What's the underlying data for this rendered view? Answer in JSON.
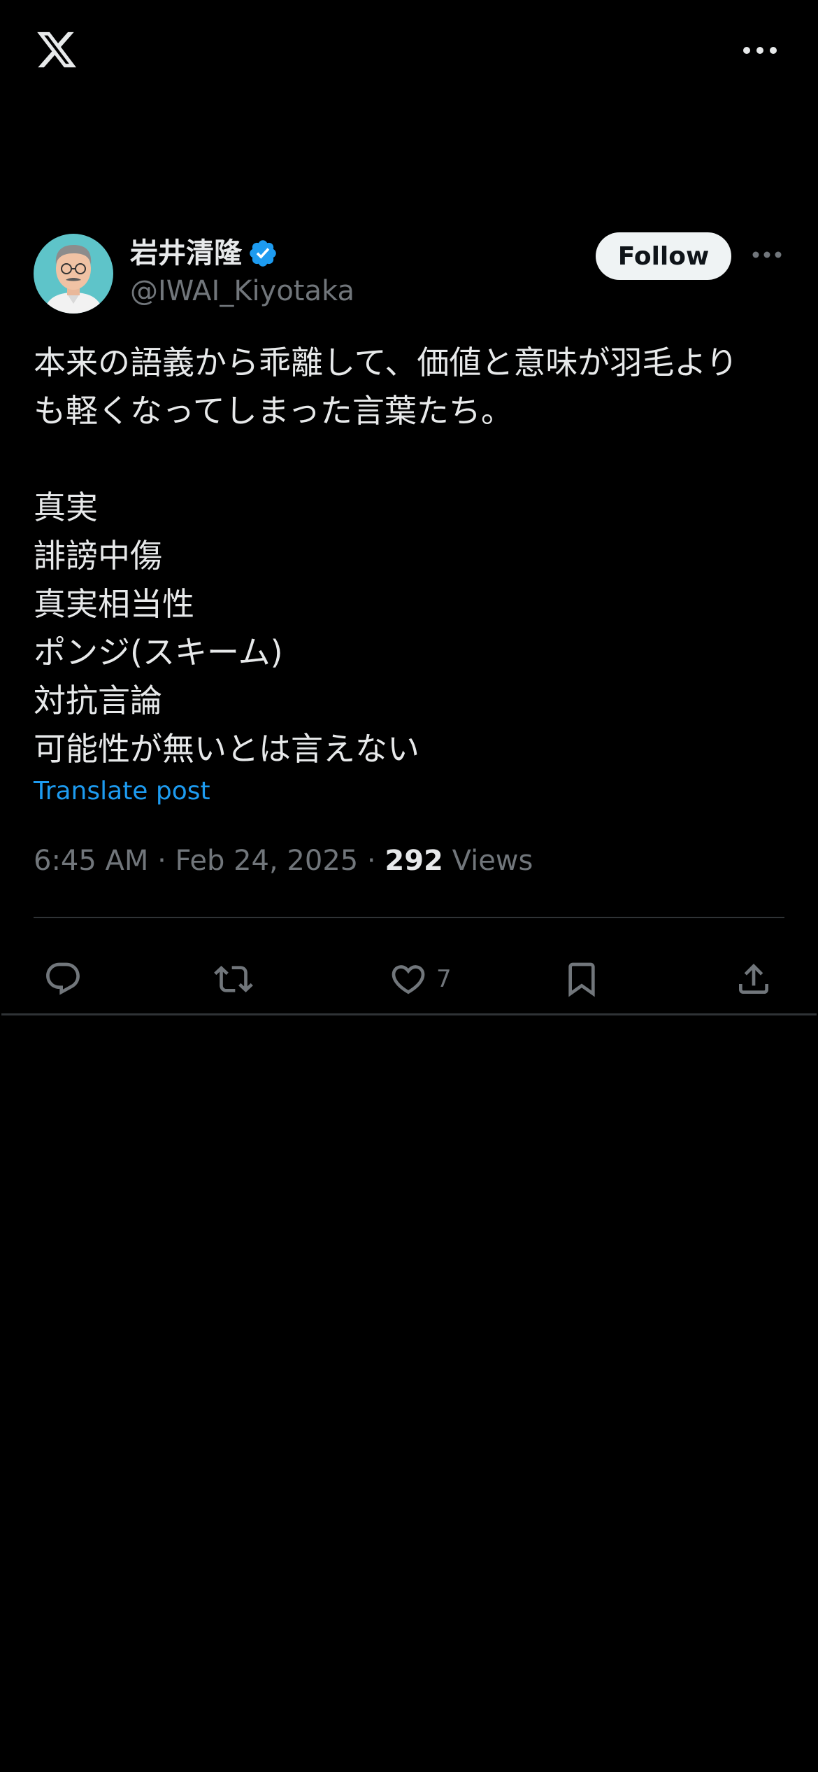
{
  "header": {
    "logo_icon": "x-logo-icon",
    "more_icon": "more-horizontal-icon"
  },
  "tweet": {
    "author": {
      "display_name": "岩井清隆",
      "handle": "@IWAI_Kiyotaka",
      "verified": true,
      "verified_color": "#1d9bf0"
    },
    "follow_label": "Follow",
    "text": "本来の語義から乖離して、価値と意味が羽毛より\nも軽くなってしまった言葉たち。\n\n真実\n誹謗中傷\n真実相当性\nポンジ(スキーム)\n対抗言論\n可能性が無いとは言えない",
    "translate_label": "Translate post",
    "timestamp": "6:45 AM · Feb 24, 2025 · ",
    "views_count": "292",
    "views_label": " Views",
    "actions": {
      "reply_icon": "reply-icon",
      "retweet_icon": "retweet-icon",
      "like_icon": "heart-icon",
      "like_count": "7",
      "bookmark_icon": "bookmark-icon",
      "share_icon": "share-icon"
    }
  },
  "colors": {
    "background": "#000000",
    "text": "#e7e9ea",
    "secondary": "#71767b",
    "accent": "#1d9bf0",
    "border": "#2f3336"
  }
}
